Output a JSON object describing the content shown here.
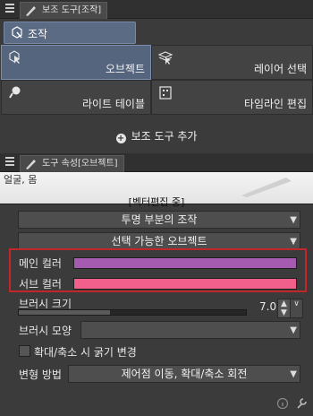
{
  "sub_tool_panel": {
    "tab_label": "보조 도구[조작]",
    "group_label": "조작",
    "tools": [
      {
        "label": "오브젝트",
        "icon": "object-arrow-icon",
        "active": true
      },
      {
        "label": "레이어 선택",
        "icon": "layer-select-icon",
        "active": false
      },
      {
        "label": "라이트 테이블",
        "icon": "light-table-icon",
        "active": false
      },
      {
        "label": "타임라인 편집",
        "icon": "timeline-edit-icon",
        "active": false
      }
    ],
    "add_button_label": "보조 도구 추가"
  },
  "tool_property_panel": {
    "tab_label": "도구 속성[오브젝트]",
    "preview_top_label": "얼굴, 몸",
    "status_label": "[벡터편집 중]",
    "transparent_operation": "투명 부분의 조작",
    "selectable_object": "선택 가능한 오브젝트",
    "main_color_label": "메인 컬러",
    "main_color": "#a55bb0",
    "sub_color_label": "서브 컬러",
    "sub_color": "#f0608a",
    "brush_size_label": "브러시 크기",
    "brush_size_value": "7.0",
    "brush_size_fraction": 0.4,
    "brush_shape_label": "브러시 모양",
    "brush_shape_value": "",
    "scale_width_label": "확대/축소 시 굵기 변경",
    "scale_width_checked": false,
    "transform_label": "변형 방법",
    "transform_value": "제어점 이동, 확대/축소 회전"
  },
  "colors": {
    "highlight_border": "#c0262a",
    "active_tool": "#56657e"
  }
}
